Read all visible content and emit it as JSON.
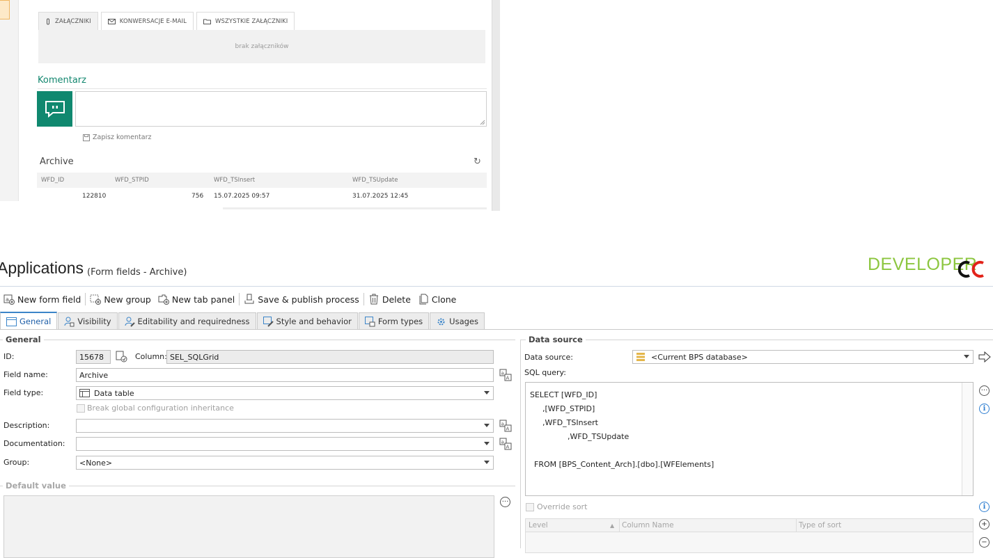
{
  "preview": {
    "attachment_tabs": [
      {
        "icon": "paperclip-icon",
        "label": "ZAŁĄCZNIKI"
      },
      {
        "icon": "envelope-icon",
        "label": "KONWERSACJE E-MAIL"
      },
      {
        "icon": "folder-icon",
        "label": "WSZYSTKIE ZAŁĄCZNIKI"
      }
    ],
    "no_attachments": "brak załączników",
    "comment_title": "Komentarz",
    "save_comment": "Zapisz komentarz",
    "archive": {
      "title": "Archive",
      "columns": [
        "WFD_ID",
        "WFD_STPID",
        "WFD_TSInsert",
        "WFD_TSUpdate"
      ],
      "row": {
        "id": "122810",
        "stpid": "756",
        "inserted": "15.07.2025 09:57",
        "updated": "31.07.2025 12:45"
      }
    }
  },
  "header": {
    "title": "Applications",
    "subtitle": "(Form fields - Archive)",
    "brand": "DEVELOPER",
    "brand_color": "#8cc63f"
  },
  "toolbar": {
    "new_form_field": "New form field",
    "new_group": "New group",
    "new_tab_panel": "New tab panel",
    "save_publish": "Save & publish process",
    "delete": "Delete",
    "clone": "Clone"
  },
  "tabs": [
    {
      "label": "General",
      "icon": "window-icon",
      "active": true
    },
    {
      "label": "Visibility",
      "icon": "visibility-icon"
    },
    {
      "label": "Editability and requiredness",
      "icon": "edit-icon"
    },
    {
      "label": "Style and behavior",
      "icon": "style-icon"
    },
    {
      "label": "Form types",
      "icon": "form-types-icon"
    },
    {
      "label": "Usages",
      "icon": "usages-icon"
    }
  ],
  "general": {
    "caption": "General",
    "id_label": "ID:",
    "id_value": "15678",
    "column_label": "Column:",
    "column_value": "SEL_SQLGrid",
    "field_name_label": "Field name:",
    "field_name_value": "Archive",
    "field_type_label": "Field type:",
    "field_type_value": "Data table",
    "break_inheritance": "Break global configuration inheritance",
    "description_label": "Description:",
    "description_value": "",
    "documentation_label": "Documentation:",
    "documentation_value": "",
    "group_label": "Group:",
    "group_value": "<None>"
  },
  "default_value": {
    "caption": "Default value"
  },
  "data_source": {
    "caption": "Data source",
    "source_label": "Data source:",
    "source_value": "<Current BPS database>",
    "sql_label": "SQL query:",
    "sql_lines": [
      "SELECT [WFD_ID]",
      ",[WFD_STPID]",
      ",WFD_TSInsert",
      ",WFD_TSUpdate",
      "FROM [BPS_Content_Arch].[dbo].[WFElements]"
    ],
    "override_sort": "Override sort",
    "sort_columns": [
      "Level",
      "Column Name",
      "Type of sort"
    ]
  }
}
